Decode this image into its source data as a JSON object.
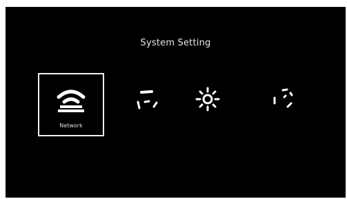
{
  "screen": {
    "title": "System Setting",
    "background": "#000000",
    "foreground": "#ffffff"
  },
  "menu": {
    "items": [
      {
        "id": "network",
        "label": "Network",
        "icon": "wifi-icon",
        "selected": true
      },
      {
        "id": "display",
        "label": "",
        "icon": "display-icon",
        "selected": false
      },
      {
        "id": "general",
        "label": "",
        "icon": "gear-icon",
        "selected": false
      },
      {
        "id": "time",
        "label": "",
        "icon": "clock-icon",
        "selected": false
      }
    ]
  }
}
